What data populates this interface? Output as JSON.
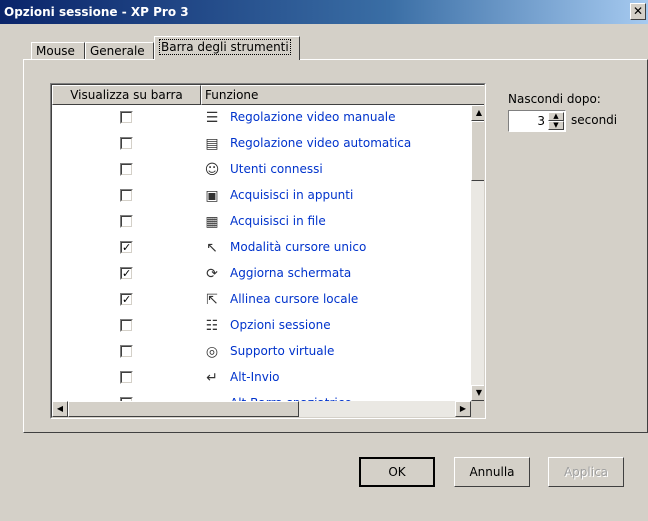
{
  "window": {
    "title": "Opzioni sessione - XP Pro 3",
    "close_glyph": "✕"
  },
  "tabs": [
    {
      "label": "Mouse"
    },
    {
      "label": "Generale"
    },
    {
      "label": "Barra degli strumenti",
      "active": true
    }
  ],
  "list": {
    "col_show": "Visualizza su barra",
    "col_function": "Funzione",
    "rows": [
      {
        "label": "Regolazione video manuale",
        "checked": false,
        "icon": "manual-video-adjust-icon"
      },
      {
        "label": "Regolazione video automatica",
        "checked": false,
        "icon": "auto-video-adjust-icon"
      },
      {
        "label": "Utenti connessi",
        "checked": false,
        "icon": "connected-users-icon"
      },
      {
        "label": "Acquisisci in appunti",
        "checked": false,
        "icon": "capture-clipboard-icon"
      },
      {
        "label": "Acquisisci in file",
        "checked": false,
        "icon": "capture-file-icon"
      },
      {
        "label": "Modalità cursore unico",
        "checked": true,
        "icon": "single-cursor-icon"
      },
      {
        "label": "Aggiorna schermata",
        "checked": true,
        "icon": "refresh-screen-icon"
      },
      {
        "label": "Allinea cursore locale",
        "checked": true,
        "icon": "align-cursor-icon"
      },
      {
        "label": "Opzioni sessione",
        "checked": false,
        "icon": "session-options-icon"
      },
      {
        "label": "Supporto virtuale",
        "checked": false,
        "icon": "virtual-media-icon"
      },
      {
        "label": "Alt-Invio",
        "checked": false,
        "icon": "alt-enter-icon"
      },
      {
        "label": "Alt-Barra spaziatrice",
        "checked": false,
        "icon": "alt-space-icon"
      }
    ]
  },
  "hide_after": {
    "label": "Nascondi dopo:",
    "value": "3",
    "unit": "secondi"
  },
  "buttons": {
    "ok": "OK",
    "cancel": "Annulla",
    "apply": "Applica"
  }
}
